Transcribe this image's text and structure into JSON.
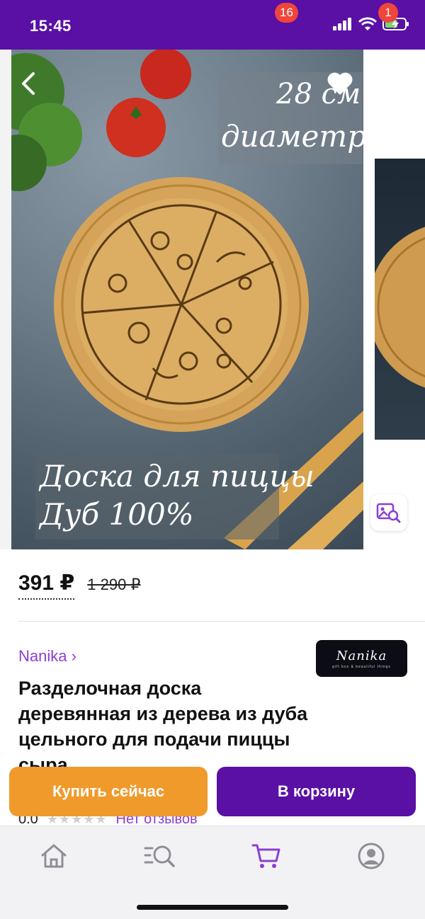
{
  "status_bar": {
    "time": "15:45"
  },
  "gallery": {
    "image_text_line1": "28 см",
    "image_text_line2": "диаметр",
    "image_caption_line1": "Доска для пиццы",
    "image_caption_line2": "Дуб 100%"
  },
  "price": {
    "current": "391 ₽",
    "old": "1 290 ₽"
  },
  "product": {
    "seller": "Nanika ›",
    "brand_logo_text": "Nanika",
    "brand_logo_subtext": "gift box & beautiful things",
    "title": "Разделочная доска деревянная из дерева из дуба цельного для подачи пиццы сыра",
    "rating": "0.0",
    "reviews": "Нет отзывов"
  },
  "actions": {
    "buy_now": "Купить сейчас",
    "add_to_cart": "В корзину"
  },
  "tab_bar": {
    "items": [
      {
        "icon": "home-icon"
      },
      {
        "icon": "catalog-search-icon"
      },
      {
        "icon": "cart-icon",
        "badge": "16"
      },
      {
        "icon": "profile-icon",
        "badge": "1"
      }
    ]
  },
  "colors": {
    "brand_purple": "#5a0fa5",
    "accent_orange": "#f09a2c",
    "link_purple": "#8a3fd4",
    "badge_red": "#f0453a"
  }
}
